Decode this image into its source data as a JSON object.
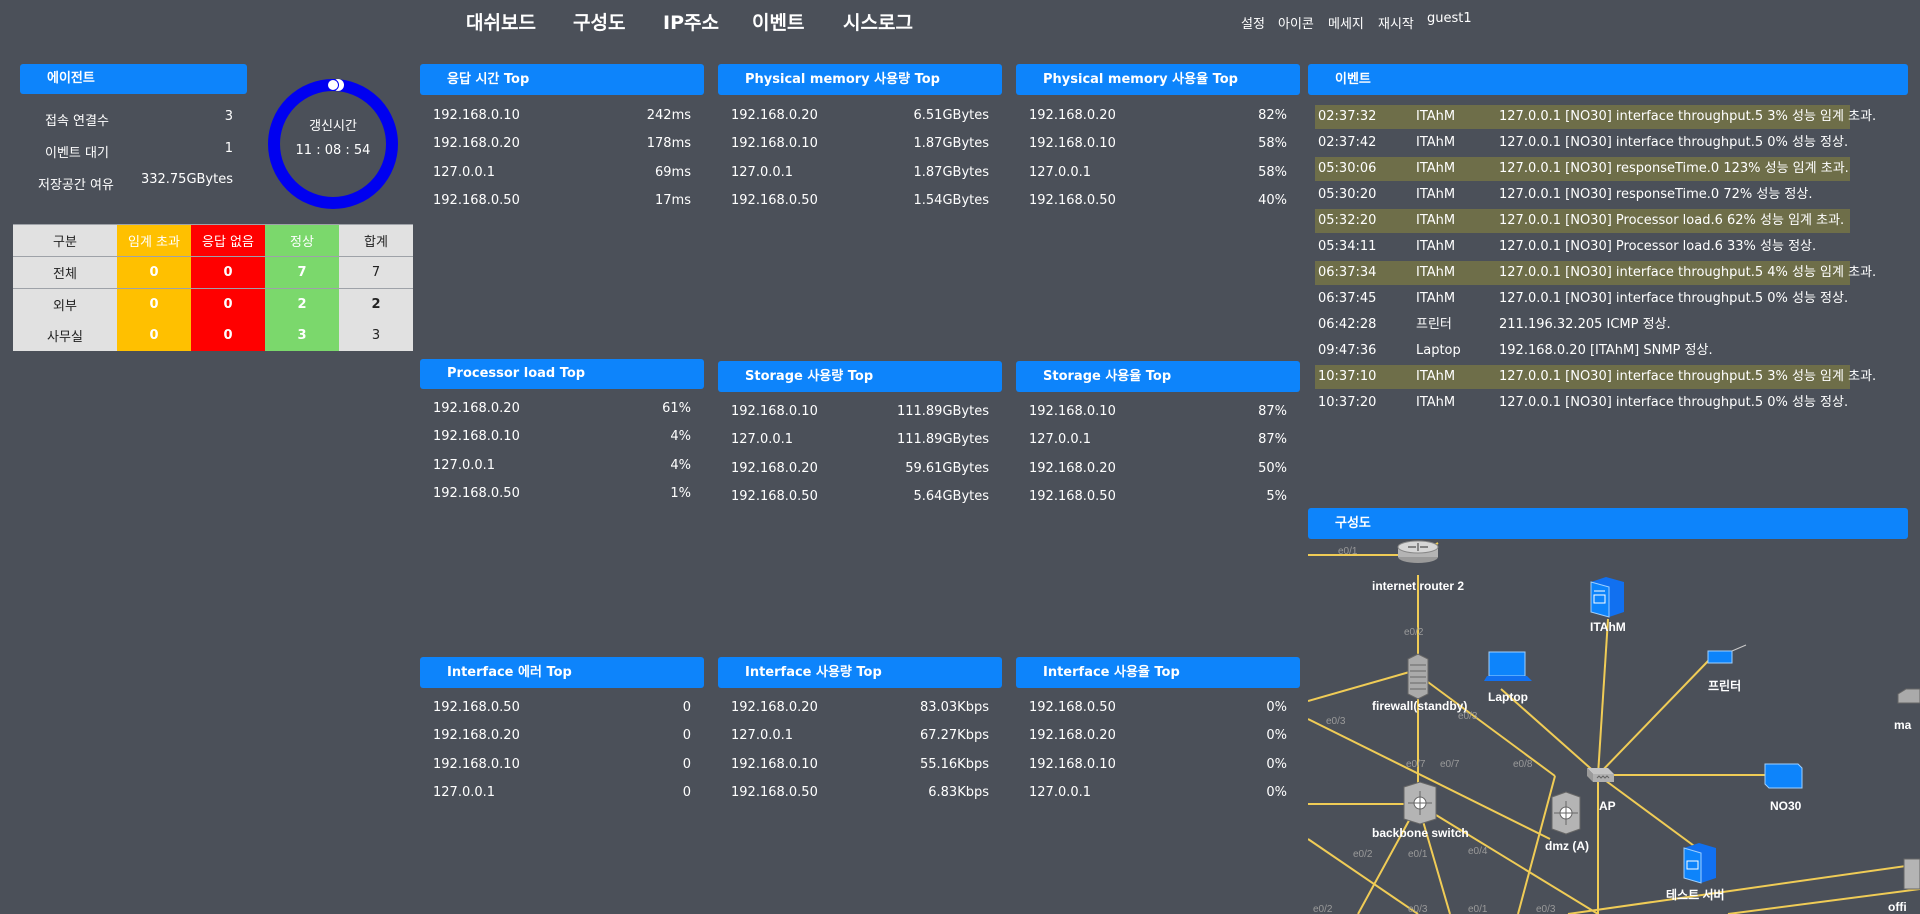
{
  "nav": {
    "dashboard": "대쉬보드",
    "topology": "구성도",
    "ip_address": "IP주소",
    "events": "이벤트",
    "syslog": "시스로그"
  },
  "top_right": {
    "settings": "설정",
    "icons": "아이콘",
    "message": "메세지",
    "restart": "재시작",
    "user": "guest1"
  },
  "agent": {
    "title": "에이전트",
    "connections_label": "접속 연결수",
    "connections_value": "3",
    "events_wait_label": "이벤트 대기",
    "events_wait_value": "1",
    "storage_free_label": "저장공간 여유",
    "storage_free_value": "332.75GBytes"
  },
  "refresh": {
    "label": "갱신시간",
    "time": "11 : 08 : 54"
  },
  "status_table": {
    "headers": [
      "구분",
      "임계 초과",
      "응답 없음",
      "정상",
      "합계"
    ],
    "rows": [
      {
        "name": "전체",
        "critical": "0",
        "no_response": "0",
        "normal": "7",
        "total": "7"
      },
      {
        "name": "외부",
        "critical": "0",
        "no_response": "0",
        "normal": "2",
        "total": "2"
      },
      {
        "name": "사무실",
        "critical": "0",
        "no_response": "0",
        "normal": "3",
        "total": "3"
      }
    ]
  },
  "panels": {
    "response_time": {
      "title": "응답 시간 Top",
      "rows": [
        {
          "host": "192.168.0.10",
          "value": "242ms"
        },
        {
          "host": "192.168.0.20",
          "value": "178ms"
        },
        {
          "host": "127.0.0.1",
          "value": "69ms"
        },
        {
          "host": "192.168.0.50",
          "value": "17ms"
        }
      ]
    },
    "phys_mem_used": {
      "title": "Physical memory 사용량 Top",
      "rows": [
        {
          "host": "192.168.0.20",
          "value": "6.51GBytes"
        },
        {
          "host": "192.168.0.10",
          "value": "1.87GBytes"
        },
        {
          "host": "127.0.0.1",
          "value": "1.87GBytes"
        },
        {
          "host": "192.168.0.50",
          "value": "1.54GBytes"
        }
      ]
    },
    "phys_mem_rate": {
      "title": "Physical memory 사용율 Top",
      "rows": [
        {
          "host": "192.168.0.20",
          "value": "82%"
        },
        {
          "host": "192.168.0.10",
          "value": "58%"
        },
        {
          "host": "127.0.0.1",
          "value": "58%"
        },
        {
          "host": "192.168.0.50",
          "value": "40%"
        }
      ]
    },
    "processor": {
      "title": "Processor load Top",
      "rows": [
        {
          "host": "192.168.0.20",
          "value": "61%"
        },
        {
          "host": "192.168.0.10",
          "value": "4%"
        },
        {
          "host": "127.0.0.1",
          "value": "4%"
        },
        {
          "host": "192.168.0.50",
          "value": "1%"
        }
      ]
    },
    "storage_used": {
      "title": "Storage 사용량 Top",
      "rows": [
        {
          "host": "192.168.0.10",
          "value": "111.89GBytes"
        },
        {
          "host": "127.0.0.1",
          "value": "111.89GBytes"
        },
        {
          "host": "192.168.0.20",
          "value": "59.61GBytes"
        },
        {
          "host": "192.168.0.50",
          "value": "5.64GBytes"
        }
      ]
    },
    "storage_rate": {
      "title": "Storage 사용율 Top",
      "rows": [
        {
          "host": "192.168.0.10",
          "value": "87%"
        },
        {
          "host": "127.0.0.1",
          "value": "87%"
        },
        {
          "host": "192.168.0.20",
          "value": "50%"
        },
        {
          "host": "192.168.0.50",
          "value": "5%"
        }
      ]
    },
    "if_error": {
      "title": "Interface 에러 Top",
      "rows": [
        {
          "host": "192.168.0.50",
          "value": "0"
        },
        {
          "host": "192.168.0.20",
          "value": "0"
        },
        {
          "host": "192.168.0.10",
          "value": "0"
        },
        {
          "host": "127.0.0.1",
          "value": "0"
        }
      ]
    },
    "if_used": {
      "title": "Interface 사용량 Top",
      "rows": [
        {
          "host": "192.168.0.20",
          "value": "83.03Kbps"
        },
        {
          "host": "127.0.0.1",
          "value": "67.27Kbps"
        },
        {
          "host": "192.168.0.10",
          "value": "55.16Kbps"
        },
        {
          "host": "192.168.0.50",
          "value": "6.83Kbps"
        }
      ]
    },
    "if_rate": {
      "title": "Interface 사용율 Top",
      "rows": [
        {
          "host": "192.168.0.50",
          "value": "0%"
        },
        {
          "host": "192.168.0.20",
          "value": "0%"
        },
        {
          "host": "192.168.0.10",
          "value": "0%"
        },
        {
          "host": "127.0.0.1",
          "value": "0%"
        }
      ]
    }
  },
  "events": {
    "title": "이벤트",
    "rows": [
      {
        "time": "02:37:32",
        "source": "ITAhM",
        "message": "127.0.0.1 [NO30] interface throughput.5 3% 성능 임계 초과.",
        "highlight": true
      },
      {
        "time": "02:37:42",
        "source": "ITAhM",
        "message": "127.0.0.1 [NO30] interface throughput.5 0% 성능 정상.",
        "highlight": false
      },
      {
        "time": "05:30:06",
        "source": "ITAhM",
        "message": "127.0.0.1 [NO30] responseTime.0 123% 성능 임계 초과.",
        "highlight": true
      },
      {
        "time": "05:30:20",
        "source": "ITAhM",
        "message": "127.0.0.1 [NO30] responseTime.0 72% 성능 정상.",
        "highlight": false
      },
      {
        "time": "05:32:20",
        "source": "ITAhM",
        "message": "127.0.0.1 [NO30] Processor load.6 62% 성능 임계 초과.",
        "highlight": true
      },
      {
        "time": "05:34:11",
        "source": "ITAhM",
        "message": "127.0.0.1 [NO30] Processor load.6 33% 성능 정상.",
        "highlight": false
      },
      {
        "time": "06:37:34",
        "source": "ITAhM",
        "message": "127.0.0.1 [NO30] interface throughput.5 4% 성능 임계 초과.",
        "highlight": true
      },
      {
        "time": "06:37:45",
        "source": "ITAhM",
        "message": "127.0.0.1 [NO30] interface throughput.5 0% 성능 정상.",
        "highlight": false
      },
      {
        "time": "06:42:28",
        "source": "프린터",
        "message": "211.196.32.205 ICMP 정상.",
        "highlight": false
      },
      {
        "time": "09:47:36",
        "source": "Laptop",
        "message": "192.168.0.20 [ITAhM] SNMP 정상.",
        "highlight": false
      },
      {
        "time": "10:37:10",
        "source": "ITAhM",
        "message": "127.0.0.1 [NO30] interface throughput.5 3% 성능 임계 초과.",
        "highlight": true
      },
      {
        "time": "10:37:20",
        "source": "ITAhM",
        "message": "127.0.0.1 [NO30] interface throughput.5 0% 성능 정상.",
        "highlight": false
      }
    ]
  },
  "topology": {
    "title": "구성도",
    "nodes": {
      "router": "internet router 2",
      "itahm": "ITAhM",
      "firewall": "firewall(standby)",
      "laptop": "Laptop",
      "printer": "프린터",
      "ap": "AP",
      "no30": "NO30",
      "backbone": "backbone switch",
      "dmz": "dmz (A)",
      "test_server": "테스트 서버",
      "office": "offi",
      "ma": "ma"
    },
    "ports": [
      "e0/1",
      "e0/2",
      "e0/3",
      "e0/3",
      "e0/7",
      "e0/7",
      "e0/8",
      "e0/4",
      "e0/2",
      "e0/1",
      "e0/2",
      "e0/3",
      "e0/1",
      "e0/3"
    ],
    "link_color": "#f0cc56"
  },
  "colors": {
    "background": "#4b5059",
    "header_blue": "#0d84fb",
    "critical": "#ffc000",
    "no_response": "#ff0000",
    "normal": "#7bd86c",
    "event_highlight": "#6e6e49",
    "ring": "#0000f0"
  }
}
